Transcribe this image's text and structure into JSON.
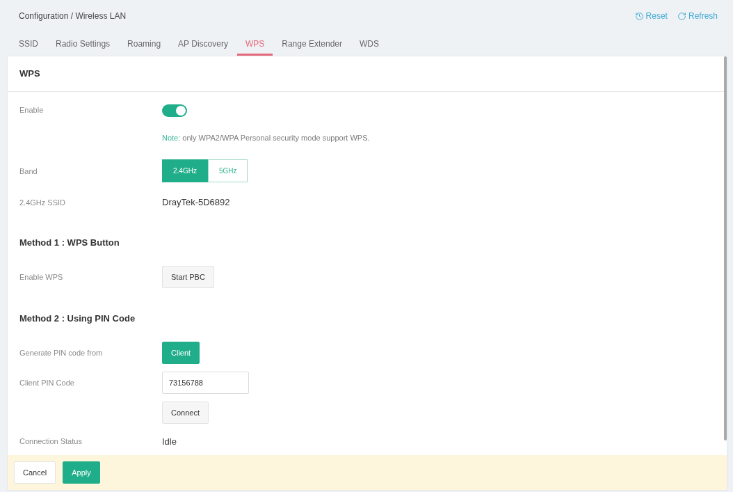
{
  "breadcrumb": "Configuration / Wireless LAN",
  "header_actions": [
    {
      "kind": "reset",
      "label": "Reset"
    },
    {
      "kind": "refresh",
      "label": "Refresh"
    }
  ],
  "tabs": [
    {
      "label": "SSID",
      "selected": false
    },
    {
      "label": "Radio Settings",
      "selected": false
    },
    {
      "label": "Roaming",
      "selected": false
    },
    {
      "label": "AP Discovery",
      "selected": false
    },
    {
      "label": "WPS",
      "selected": true
    },
    {
      "label": "Range Extender",
      "selected": false
    },
    {
      "label": "WDS",
      "selected": false
    }
  ],
  "panel": {
    "title": "WPS",
    "rows": [
      {
        "kind": "toggle",
        "label": "Enable",
        "on": true
      },
      {
        "kind": "note",
        "note_label": "Note:",
        "text": "only WPA2/WPA Personal security mode support WPS."
      },
      {
        "kind": "segmented",
        "label": "Band",
        "options": [
          {
            "label": "2.4GHz",
            "selected": true
          },
          {
            "label": "5GHz",
            "selected": false
          }
        ]
      },
      {
        "kind": "text",
        "label": "2.4GHz SSID",
        "value": "DrayTek-5D6892"
      },
      {
        "kind": "heading",
        "text": "Method 1 : WPS Button"
      },
      {
        "kind": "button",
        "label": "Enable WPS",
        "button": {
          "label": "Start PBC",
          "kind": "default"
        }
      },
      {
        "kind": "heading",
        "text": "Method 2 : Using PIN Code"
      },
      {
        "kind": "button",
        "label": "Generate PIN code from",
        "button": {
          "label": "Client",
          "kind": "primary"
        }
      },
      {
        "kind": "input",
        "label": "Client PIN Code",
        "value": "73156788"
      },
      {
        "kind": "button",
        "button": {
          "label": "Connect",
          "kind": "default"
        }
      },
      {
        "kind": "text",
        "label": "Connection Status",
        "value": "Idle"
      }
    ]
  },
  "footer": {
    "buttons": [
      {
        "label": "Cancel",
        "kind": "default"
      },
      {
        "label": "Apply",
        "kind": "primary"
      }
    ]
  }
}
